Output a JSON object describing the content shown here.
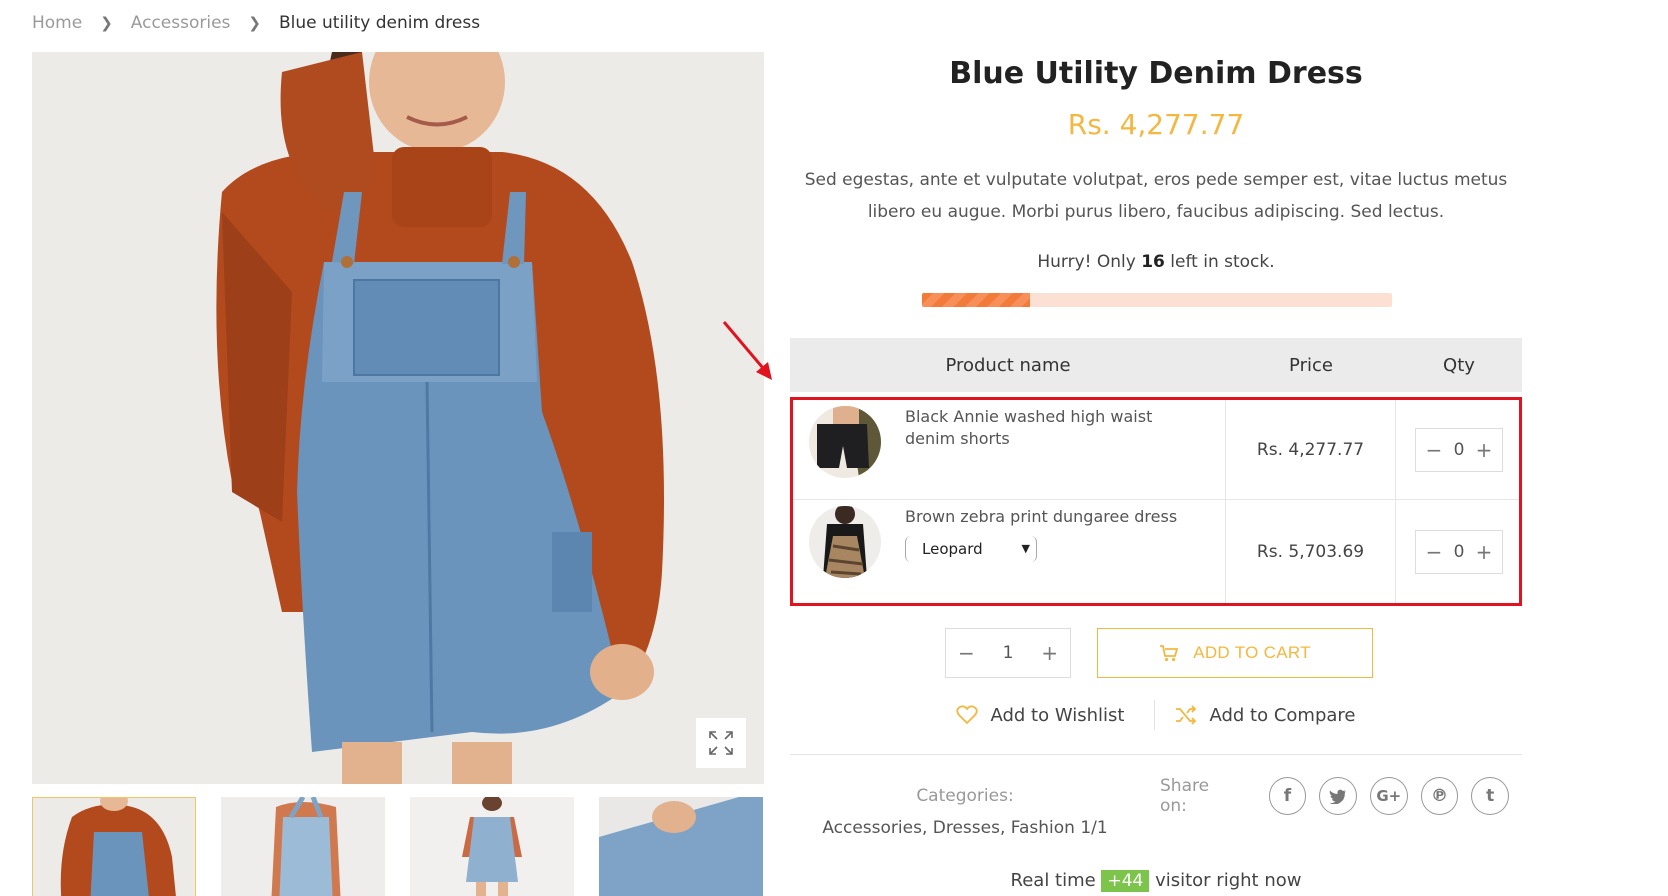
{
  "breadcrumb": {
    "home": "Home",
    "category": "Accessories",
    "current": "Blue utility denim dress"
  },
  "product": {
    "title": "Blue Utility Denim Dress",
    "price": "Rs. 4,277.77",
    "description": "Sed egestas, ante et vulputate volutpat, eros pede semper est, vitae luctus metus libero eu augue. Morbi purus libero, faucibus adipiscing. Sed lectus.",
    "stock_prefix": "Hurry! Only",
    "stock_count": "16",
    "stock_suffix": "left in stock.",
    "stock_fill_fraction": 0.23
  },
  "group_table": {
    "headers": [
      "Product name",
      "Price",
      "Qty"
    ],
    "rows": [
      {
        "name": "Black Annie washed high waist denim shorts",
        "price": "Rs. 4,277.77",
        "qty": "0"
      },
      {
        "name": "Brown zebra print dungaree dress",
        "variant": "Leopard",
        "price": "Rs. 5,703.69",
        "qty": "0"
      }
    ]
  },
  "cart": {
    "qty": "1",
    "minus": "−",
    "plus": "+",
    "add_to_cart": "ADD TO CART"
  },
  "actions": {
    "wishlist": "Add to Wishlist",
    "compare": "Add to Compare"
  },
  "meta": {
    "categories_label": "Categories:",
    "categories_value": "Accessories, Dresses, Fashion 1/1",
    "share_label": "Share on:"
  },
  "visitors": {
    "prefix": "Real time",
    "count": "+44",
    "suffix": "visitor right now"
  },
  "colors": {
    "accent": "#f4b73f",
    "highlight_border": "#e0131e",
    "stock_bar": "#f37b3a",
    "visitor_badge": "#7cc44c"
  },
  "icons": [
    "chevron-right-icon",
    "expand-icon",
    "cart-icon",
    "heart-icon",
    "shuffle-icon",
    "facebook-icon",
    "twitter-icon",
    "google-plus-icon",
    "pinterest-icon",
    "tumblr-icon",
    "caret-down-icon"
  ]
}
